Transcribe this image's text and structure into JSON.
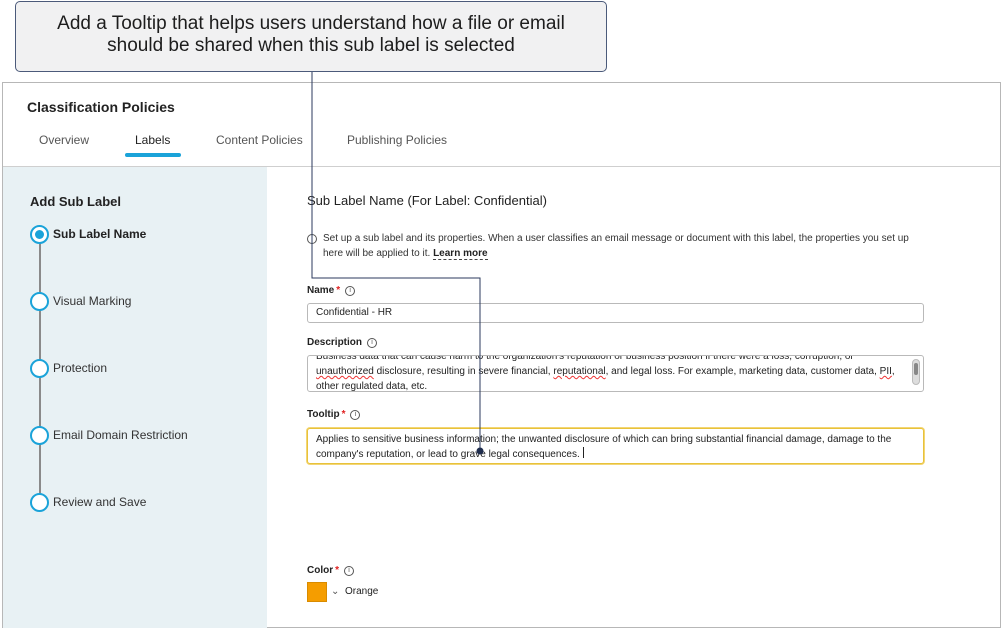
{
  "callout": {
    "line1": "Add a Tooltip that helps users understand how a file or email",
    "line2": "should be shared when this sub label is selected"
  },
  "app": {
    "title": "Classification Policies"
  },
  "tabs": [
    {
      "label": "Overview"
    },
    {
      "label": "Labels"
    },
    {
      "label": "Content Policies"
    },
    {
      "label": "Publishing Policies"
    }
  ],
  "sidebar": {
    "title": "Add Sub Label",
    "steps": [
      {
        "label": "Sub Label Name"
      },
      {
        "label": "Visual Marking"
      },
      {
        "label": "Protection"
      },
      {
        "label": "Email Domain Restriction"
      },
      {
        "label": "Review and Save"
      }
    ]
  },
  "main": {
    "section_title": "Sub Label Name (For Label: Confidential)",
    "info_text": "Set up a sub label and its properties. When a user classifies an email message or document with this label, the properties you set up here will be applied to it.",
    "learn_more": "Learn more",
    "name": {
      "label": "Name",
      "required": "*",
      "value": "Confidential - HR"
    },
    "description": {
      "label": "Description",
      "line1": "Business data that can cause harm to the organization's reputation or business position if there were a loss, corruption, or",
      "line2a": "unauthorized",
      "line2b": " disclosure, resulting in severe financial, ",
      "line2c": "reputational",
      "line2d": ", and legal loss. For example, marketing data, customer data, ",
      "line2e": "PII",
      "line2f": ",",
      "line3": "other regulated data, etc."
    },
    "tooltip": {
      "label": "Tooltip",
      "required": "*",
      "value": "Applies to sensitive business information; the unwanted disclosure of which can bring substantial financial damage, damage to the company's reputation, or lead to grave legal consequences."
    },
    "color": {
      "label": "Color",
      "required": "*",
      "value": "Orange",
      "swatch_hex": "#f59d00"
    }
  },
  "icons": {
    "info": "info-circle-icon",
    "chevron": "chevron-down-icon"
  },
  "colors": {
    "accent": "#1aa3d9",
    "sidebar_bg": "#e8f1f4",
    "focus": "#e8c23a",
    "required": "#e02020"
  }
}
